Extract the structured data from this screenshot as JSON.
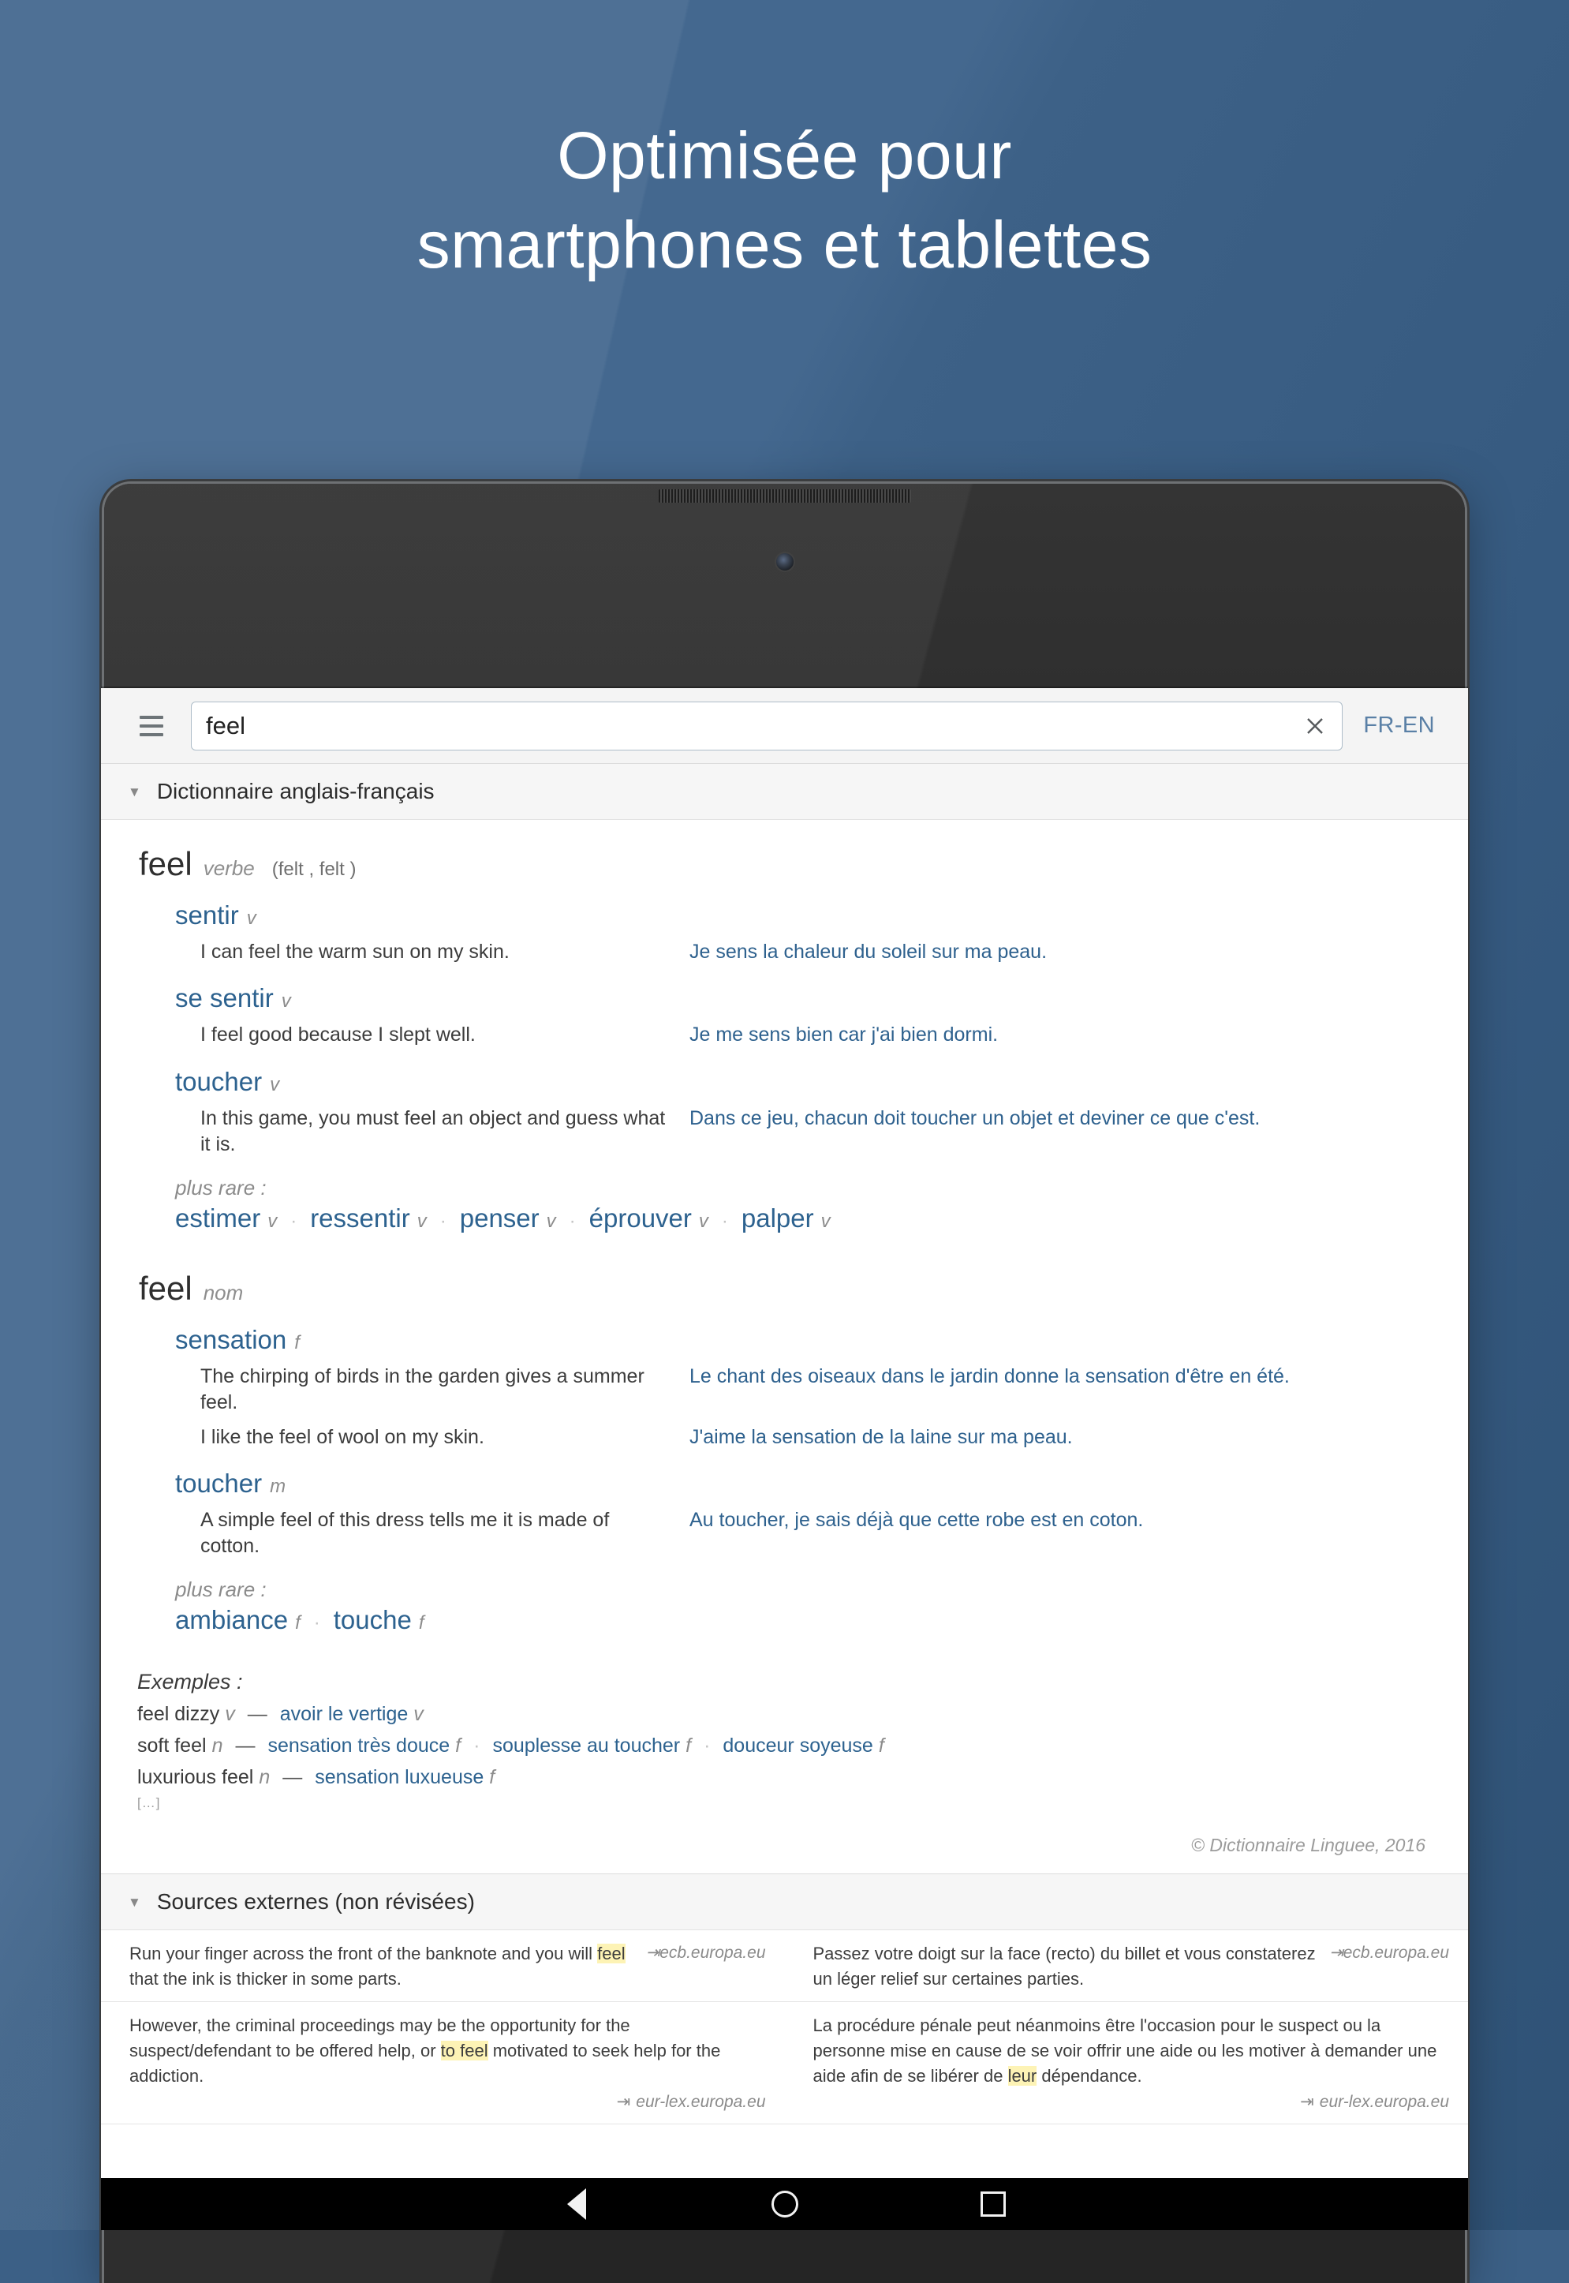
{
  "promo": {
    "headline_line1": "Optimisée pour",
    "headline_line2": "smartphones et tablettes",
    "background_color": "#3d6187",
    "text_color": "#ffffff"
  },
  "app_bar": {
    "menu_icon": "hamburger-menu-icon",
    "search_value": "feel",
    "search_placeholder": "feel",
    "clear_icon": "close-icon",
    "lang_toggle": "FR-EN",
    "link_color": "#5a80a6"
  },
  "dictionary_section": {
    "caret": "▼",
    "title": "Dictionnaire anglais-français",
    "entries": [
      {
        "word": "feel",
        "pos": "verbe",
        "forms": "(felt , felt )",
        "senses": [
          {
            "term": "sentir",
            "gender": "v",
            "examples": [
              {
                "source": "I can feel the warm sun on my skin.",
                "target": "Je sens la chaleur du soleil sur ma peau."
              }
            ]
          },
          {
            "term": "se sentir",
            "gender": "v",
            "examples": [
              {
                "source": "I feel good because I slept well.",
                "target": "Je me sens bien car j'ai bien dormi."
              }
            ]
          },
          {
            "term": "toucher",
            "gender": "v",
            "examples": [
              {
                "source": "In this game, you must feel an object and guess what it is.",
                "target": "Dans ce jeu, chacun doit toucher un objet et deviner ce que c'est."
              }
            ]
          }
        ],
        "plus_rare_label": "plus rare :",
        "plus_rare": [
          {
            "term": "estimer",
            "gender": "v"
          },
          {
            "term": "ressentir",
            "gender": "v"
          },
          {
            "term": "penser",
            "gender": "v"
          },
          {
            "term": "éprouver",
            "gender": "v"
          },
          {
            "term": "palper",
            "gender": "v"
          }
        ]
      },
      {
        "word": "feel",
        "pos": "nom",
        "forms": "",
        "senses": [
          {
            "term": "sensation",
            "gender": "f",
            "examples": [
              {
                "source": "The chirping of birds in the garden gives a summer feel.",
                "target": "Le chant des oiseaux dans le jardin donne la sensation d'être en été."
              },
              {
                "source": "I like the feel of wool on my skin.",
                "target": "J'aime la sensation de la laine sur ma peau."
              }
            ]
          },
          {
            "term": "toucher",
            "gender": "m",
            "examples": [
              {
                "source": "A simple feel of this dress tells me it is made of cotton.",
                "target": "Au toucher, je sais déjà que cette robe est en coton."
              }
            ]
          }
        ],
        "plus_rare_label": "plus rare :",
        "plus_rare": [
          {
            "term": "ambiance",
            "gender": "f"
          },
          {
            "term": "touche",
            "gender": "f"
          }
        ]
      }
    ],
    "examples_title": "Exemples :",
    "examples": [
      {
        "source": "feel dizzy",
        "source_pos": "v",
        "dash": "—",
        "translations": [
          {
            "term": "avoir le vertige",
            "gender": "v"
          }
        ]
      },
      {
        "source": "soft feel",
        "source_pos": "n",
        "dash": "—",
        "translations": [
          {
            "term": "sensation très douce",
            "gender": "f"
          },
          {
            "term": "souplesse au toucher",
            "gender": "f"
          },
          {
            "term": "douceur soyeuse",
            "gender": "f"
          }
        ]
      },
      {
        "source": "luxurious feel",
        "source_pos": "n",
        "dash": "—",
        "translations": [
          {
            "term": "sensation luxueuse",
            "gender": "f"
          }
        ]
      }
    ],
    "more_indicator": "[…]",
    "copyright": "© Dictionnaire Linguee, 2016"
  },
  "external_section": {
    "caret": "▼",
    "title": "Sources externes (non révisées)",
    "rows": [
      {
        "source_prefix": "Run your finger across the front of the banknote and you will ",
        "source_highlight": "feel",
        "source_suffix": " that the ink is thicker in some parts.",
        "source_attribution": "ecb.europa.eu",
        "target_text": "Passez votre doigt sur la face (recto) du billet et vous constaterez un léger relief sur certaines parties.",
        "target_highlight": "",
        "target_attribution": "ecb.europa.eu"
      },
      {
        "source_prefix": "However, the criminal proceedings may be the opportunity for the suspect/defendant to be offered help, or ",
        "source_highlight": "to feel",
        "source_suffix": " motivated to seek help for the addiction.",
        "source_attribution": "eur-lex.europa.eu",
        "target_prefix": "La procédure pénale peut néanmoins être l'occasion pour le suspect ou la personne mise en cause de se voir offrir une aide ou les motiver à demander une aide afin de se libérer de ",
        "target_highlight": "leur",
        "target_suffix": " dépendance.",
        "target_attribution": "eur-lex.europa.eu"
      }
    ],
    "link_glyph": "⇥",
    "highlight_color": "#fdf3b5"
  },
  "nav_bar": {
    "back_icon": "back-triangle-icon",
    "home_icon": "home-circle-icon",
    "recents_icon": "recents-square-icon"
  }
}
